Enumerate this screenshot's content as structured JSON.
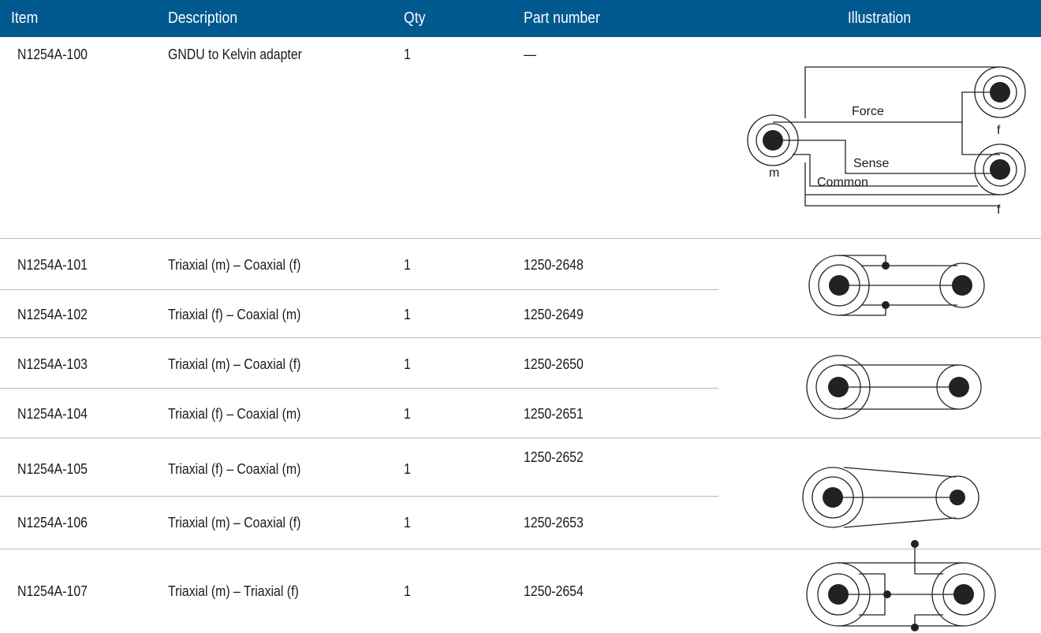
{
  "header": {
    "item": "Item",
    "description": "Description",
    "qty": "Qty",
    "part_number": "Part number",
    "illustration": "Illustration"
  },
  "rows": [
    {
      "item": "N1254A-100",
      "description": "GNDU to Kelvin adapter",
      "qty": "1",
      "part_number": "—"
    },
    {
      "item": "N1254A-101",
      "description": "Triaxial (m) – Coaxial (f)",
      "qty": "1",
      "part_number": "1250-2648"
    },
    {
      "item": "N1254A-102",
      "description": "Triaxial (f) – Coaxial (m)",
      "qty": "1",
      "part_number": "1250-2649"
    },
    {
      "item": "N1254A-103",
      "description": "Triaxial (m) – Coaxial (f)",
      "qty": "1",
      "part_number": "1250-2650"
    },
    {
      "item": "N1254A-104",
      "description": "Triaxial (f) – Coaxial (m)",
      "qty": "1",
      "part_number": "1250-2651"
    },
    {
      "item": "N1254A-105",
      "description": "Triaxial (f) – Coaxial (m)",
      "qty": "1",
      "part_number": "1250-2652"
    },
    {
      "item": "N1254A-106",
      "description": "Triaxial (m) – Coaxial (f)",
      "qty": "1",
      "part_number": "1250-2653"
    },
    {
      "item": "N1254A-107",
      "description": "Triaxial (m) – Triaxial (f)",
      "qty": "1",
      "part_number": "1250-2654"
    }
  ],
  "kelvin_diagram": {
    "force_label": "Force",
    "sense_label": "Sense",
    "common_label": "Common",
    "male_label": "m",
    "female_label_top": "f",
    "female_label_bottom": "f"
  }
}
